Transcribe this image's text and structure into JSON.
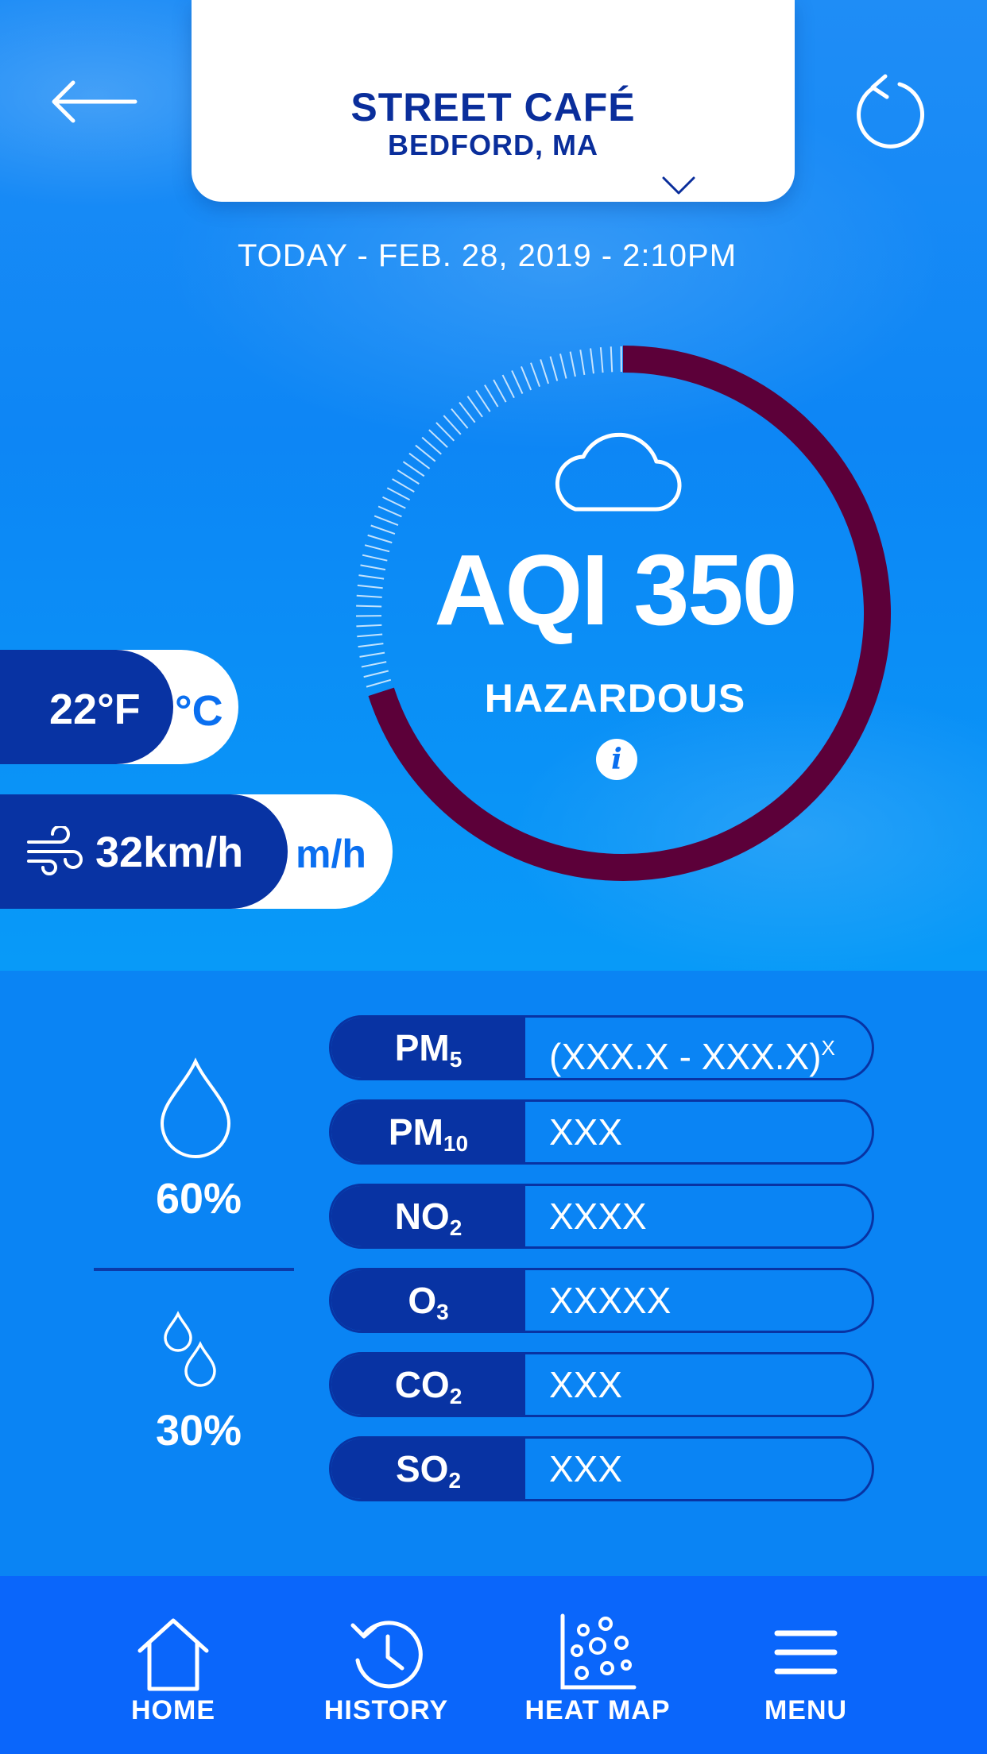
{
  "location": {
    "name": "STREET CAFÉ",
    "city": "BEDFORD, MA"
  },
  "datetime": "TODAY - FEB. 28, 2019 - 2:10PM",
  "aqi": {
    "value_text": "AQI 350",
    "level": "HAZARDOUS",
    "info_icon": "i",
    "gauge_fraction": 0.7,
    "gauge_color": "#5c0039"
  },
  "temperature": {
    "value": "22°F",
    "alt_unit": "°C"
  },
  "wind": {
    "value": "32km/h",
    "alt_unit": "m/h"
  },
  "humidity": {
    "value": "60%"
  },
  "precipitation": {
    "value": "30%"
  },
  "pollutants": [
    {
      "base": "PM",
      "sub": "5",
      "value": "(XXX.X - XXX.X)",
      "sup": "X"
    },
    {
      "base": "PM",
      "sub": "10",
      "value": "XXX",
      "sup": ""
    },
    {
      "base": "NO",
      "sub": "2",
      "value": "XXXX",
      "sup": ""
    },
    {
      "base": "O",
      "sub": "3",
      "value": "XXXXX",
      "sup": ""
    },
    {
      "base": "CO",
      "sub": "2",
      "value": "XXX",
      "sup": ""
    },
    {
      "base": "SO",
      "sub": "2",
      "value": "XXX",
      "sup": ""
    }
  ],
  "nav": {
    "home": "HOME",
    "history": "HISTORY",
    "heatmap": "HEAT MAP",
    "menu": "MENU"
  },
  "colors": {
    "navy": "#0833a3",
    "accent": "#0a6ff0",
    "nav_bg": "#0a66fb"
  }
}
